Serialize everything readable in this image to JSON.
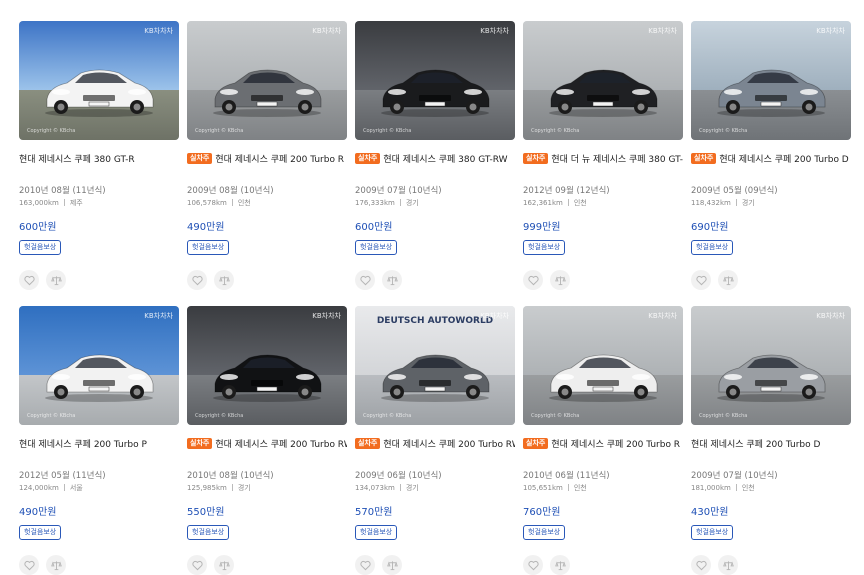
{
  "watermark": "KB차차차",
  "copyright": "Copyright © KBcha",
  "badge_label": "실차주",
  "listings": [
    {
      "title": "현대 제네시스 쿠페 380 GT-R",
      "badge": false,
      "year": "2010년 08월 (11년식)",
      "mileage": "163,000km",
      "region": "제주",
      "price": "600만원",
      "tag": "헛걸음보상",
      "car_color": "#f3f3f3",
      "bg": "sky"
    },
    {
      "title": "현대 제네시스 쿠페 200 Turbo R",
      "badge": true,
      "year": "2009년 08월 (10년식)",
      "mileage": "106,578km",
      "region": "인천",
      "price": "490만원",
      "tag": "헛걸음보상",
      "car_color": "#6b6e72",
      "bg": "garage"
    },
    {
      "title": "현대 제네시스 쿠페 380 GT-RW",
      "badge": true,
      "year": "2009년 07월 (10년식)",
      "mileage": "176,333km",
      "region": "경기",
      "price": "600만원",
      "tag": "헛걸음보상",
      "car_color": "#1a1b1d",
      "bg": "dark"
    },
    {
      "title": "현대 더 뉴 제네시스 쿠페 380 GT-R",
      "badge": true,
      "year": "2012년 09월 (12년식)",
      "mileage": "162,361km",
      "region": "인천",
      "price": "999만원",
      "tag": "헛걸음보상",
      "car_color": "#1f2023",
      "bg": "garage"
    },
    {
      "title": "현대 제네시스 쿠페 200 Turbo D",
      "badge": true,
      "year": "2009년 05월 (09년식)",
      "mileage": "118,432km",
      "region": "경기",
      "price": "690만원",
      "tag": "헛걸음보상",
      "car_color": "#7b8591",
      "bg": "lot"
    },
    {
      "title": "현대 제네시스 쿠페 200 Turbo P",
      "badge": false,
      "year": "2012년 05월 (11년식)",
      "mileage": "124,000km",
      "region": "서울",
      "price": "490만원",
      "tag": "헛걸음보상",
      "car_color": "#f2f2f2",
      "bg": "blue"
    },
    {
      "title": "현대 제네시스 쿠페 200 Turbo RW",
      "badge": true,
      "year": "2010년 08월 (10년식)",
      "mileage": "125,985km",
      "region": "경기",
      "price": "550만원",
      "tag": "헛걸음보상",
      "car_color": "#111214",
      "bg": "dark"
    },
    {
      "title": "현대 제네시스 쿠페 200 Turbo RW",
      "badge": true,
      "year": "2009년 06월 (10년식)",
      "mileage": "134,073km",
      "region": "경기",
      "price": "570만원",
      "tag": "헛걸음보상",
      "car_color": "#5e6267",
      "bg": "studio",
      "studio_text": "DEUTSCH AUTOWORLD"
    },
    {
      "title": "현대 제네시스 쿠페 200 Turbo R",
      "badge": true,
      "year": "2010년 06월 (11년식)",
      "mileage": "105,651km",
      "region": "인천",
      "price": "760만원",
      "tag": "헛걸음보상",
      "car_color": "#eeeeee",
      "bg": "garage"
    },
    {
      "title": "현대 제네시스 쿠페 200 Turbo D",
      "badge": false,
      "year": "2009년 07월 (10년식)",
      "mileage": "181,000km",
      "region": "인천",
      "price": "430만원",
      "tag": "헛걸음보상",
      "car_color": "#9a9ea3",
      "bg": "garage"
    }
  ],
  "icons": {
    "favorite": "heart-icon",
    "compare": "scale-icon"
  }
}
